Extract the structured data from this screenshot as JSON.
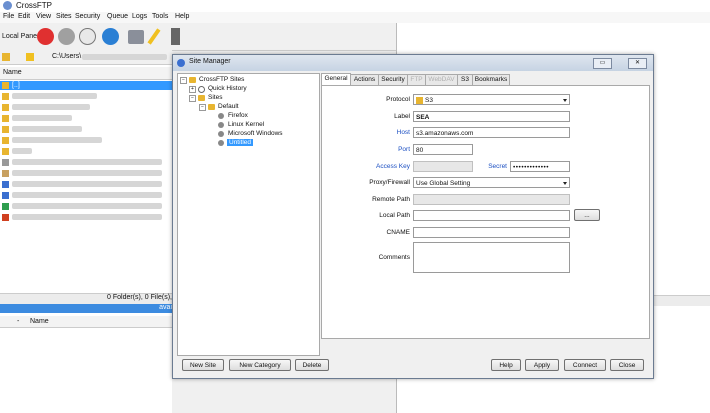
{
  "app": {
    "title": "CrossFTP"
  },
  "menu": [
    "File",
    "Edit",
    "View",
    "Sites",
    "Security",
    "Queue",
    "Logs",
    "Tools",
    "Help"
  ],
  "left_pane": {
    "label": "Local Pane",
    "path": "C:\\Users\\",
    "column_name": "Name",
    "first_row": "[..]",
    "status": "0 Folder(s), 0 File(s),",
    "status2": "avai",
    "lower_columns": {
      "dash": "-",
      "name": "Name"
    }
  },
  "dialog": {
    "title": "Site Manager",
    "tree": {
      "root": "CrossFTP Sites",
      "quick_history": "Quick History",
      "sites": "Sites",
      "default": "Default",
      "items": [
        "Firefox",
        "Linux Kernel",
        "Microsoft Windows",
        "Untitled"
      ],
      "selected": "Untitled"
    },
    "tabs": [
      "General",
      "Actions",
      "Security",
      "FTP",
      "WebDAV",
      "S3",
      "Bookmarks"
    ],
    "active_tab": "General",
    "disabled_tabs": [
      "FTP",
      "WebDAV"
    ],
    "form": {
      "protocol_label": "Protocol",
      "protocol_value": "S3",
      "label_label": "Label",
      "label_value": "SEA",
      "host_label": "Host",
      "host_value": "s3.amazonaws.com",
      "port_label": "Port",
      "port_value": "80",
      "access_key_label": "Access Key",
      "secret_label": "Secret",
      "secret_value": "•••••••••••••",
      "proxy_label": "Proxy/Firewall",
      "proxy_value": "Use Global Setting",
      "remote_path_label": "Remote Path",
      "local_path_label": "Local Path",
      "browse_label": "...",
      "cname_label": "CNAME",
      "comments_label": "Comments"
    },
    "buttons": {
      "new_site": "New Site",
      "new_category": "New Category",
      "delete": "Delete",
      "help": "Help",
      "apply": "Apply",
      "connect": "Connect",
      "close": "Close"
    }
  },
  "colors": {
    "accent": "#3399ff",
    "link_label": "#1b4fc2",
    "status_bar": "#3c8be0"
  }
}
